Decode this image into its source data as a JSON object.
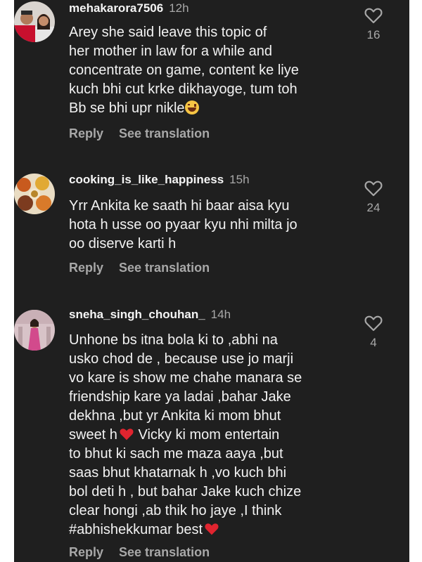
{
  "comments": [
    {
      "username": "mehakarora7506",
      "time": "12h",
      "lines": [
        "Arey she said leave this topic of",
        "her mother in law for a while and",
        "concentrate on game, content ke liye",
        "kuch bhi cut krke dikhayoge, tum toh",
        "Bb se bhi upr nikle"
      ],
      "likes": "16",
      "reply_label": "Reply",
      "translate_label": "See translation"
    },
    {
      "username": "cooking_is_like_happiness",
      "time": "15h",
      "lines": [
        "Yrr Ankita ke saath hi baar aisa kyu",
        "hota h usse oo pyaar kyu nhi milta jo",
        "oo diserve karti h"
      ],
      "likes": "24",
      "reply_label": "Reply",
      "translate_label": "See translation"
    },
    {
      "username": "sneha_singh_chouhan_",
      "time": "14h",
      "lines": [
        "Unhone bs itna bola ki to ,abhi na",
        "usko chod de , because use jo marji",
        "vo kare is show me chahe manara se",
        "friendship kare ya ladai ,bahar Jake",
        "dekhna ,but yr Ankita ki mom bhut",
        "sweet h",
        "to bhut ki sach me maza aaya ,but",
        "saas bhut khatarnak h ,vo kuch bhi",
        "bol deti h , but bahar Jake kuch chize",
        "clear hongi ,ab thik ho jaye ,I think",
        "#abhishekkumar  best"
      ],
      "line6_tail": " Vicky ki mom entertain",
      "likes": "4",
      "reply_label": "Reply",
      "translate_label": "See translation"
    }
  ],
  "colors": {
    "background": "#1f1f1f",
    "text": "#f2f2f2",
    "muted": "#a8a8a8",
    "heart_emoji": "#e0242f"
  },
  "icons": {
    "like": "heart-outline-icon",
    "laugh_emoji": "laughing-emoji-icon",
    "red_heart": "red-heart-emoji-icon"
  }
}
